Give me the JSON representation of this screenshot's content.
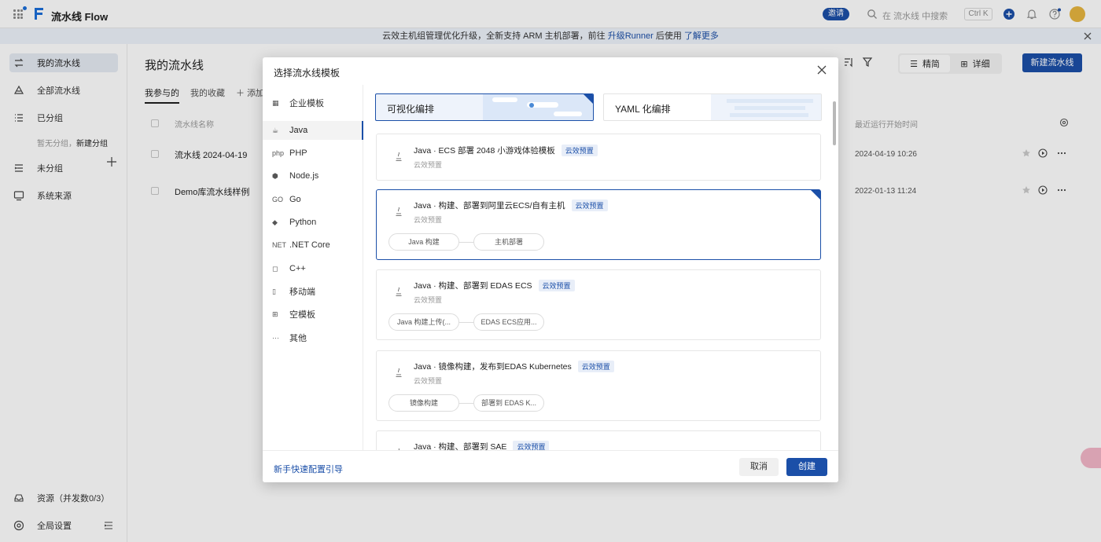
{
  "app": {
    "title": "流水线 Flow",
    "invite_label": "邀请",
    "search_placeholder": "在 流水线 中搜索",
    "shortcut": "Ctrl K"
  },
  "announcement": {
    "text_before": "云效主机组管理优化升级，全新支持 ARM 主机部署，前往 ",
    "link_upgrade": "升级Runner",
    "text_after": " 后使用 ",
    "link_more": "了解更多"
  },
  "sidebar": {
    "items": [
      {
        "label": "我的流水线",
        "icon": "pipeline-icon"
      },
      {
        "label": "全部流水线",
        "icon": "all-pipelines-icon"
      },
      {
        "label": "已分组",
        "icon": "grouped-icon"
      },
      {
        "label": "未分组",
        "icon": "ungrouped-icon"
      },
      {
        "label": "系统来源",
        "icon": "system-source-icon"
      }
    ],
    "no_group_text": "暂无分组，",
    "new_group_link": "新建分组",
    "resources_label": "资源（并发数0/3）",
    "global_settings_label": "全局设置"
  },
  "main": {
    "title": "我的流水线",
    "tabs": [
      "我参与的",
      "我的收藏",
      "添加"
    ],
    "view_compact": "精简",
    "view_detail": "详细",
    "new_pipeline_button": "新建流水线",
    "col_name": "流水线名称",
    "col_last_run": "最近运行开始时间",
    "rows": [
      {
        "name": "流水线 2024-04-19",
        "time": "2024-04-19 10:26"
      },
      {
        "name": "Demo库流水线样例",
        "time": "2022-01-13 11:24"
      }
    ]
  },
  "dialog": {
    "title": "选择流水线模板",
    "categories": [
      {
        "label": "企业模板",
        "icon": "enterprise-icon"
      },
      {
        "label": "Java",
        "icon": "java-icon"
      },
      {
        "label": "PHP",
        "icon": "php-icon"
      },
      {
        "label": "Node.js",
        "icon": "nodejs-icon"
      },
      {
        "label": "Go",
        "icon": "go-icon"
      },
      {
        "label": "Python",
        "icon": "python-icon"
      },
      {
        "label": ".NET Core",
        "icon": "dotnet-icon"
      },
      {
        "label": "C++",
        "icon": "cpp-icon"
      },
      {
        "label": "移动端",
        "icon": "mobile-icon"
      },
      {
        "label": "空模板",
        "icon": "empty-template-icon"
      },
      {
        "label": "其他",
        "icon": "more-icon"
      }
    ],
    "selected_category": "Java",
    "mode_visual": "可视化编排",
    "mode_yaml": "YAML 化编排",
    "templates": [
      {
        "name": "Java · ECS 部署 2048 小游戏体验模板",
        "badge": "云效预置",
        "sub": "云效预置",
        "stages": []
      },
      {
        "name": "Java · 构建、部署到阿里云ECS/自有主机",
        "badge": "云效预置",
        "sub": "云效预置",
        "stages": [
          "Java 构建",
          "主机部署"
        ]
      },
      {
        "name": "Java · 构建、部署到 EDAS ECS",
        "badge": "云效预置",
        "sub": "云效预置",
        "stages": [
          "Java 构建上传(...",
          "EDAS ECS应用..."
        ]
      },
      {
        "name": "Java · 镜像构建，发布到EDAS Kubernetes",
        "badge": "云效预置",
        "sub": "云效预置",
        "stages": [
          "镜像构建",
          "部署到 EDAS K..."
        ]
      },
      {
        "name": "Java · 构建、部署到 SAE",
        "badge": "云效预置",
        "sub": "",
        "stages": []
      }
    ],
    "guide_link": "新手快速配置引导",
    "cancel_label": "取消",
    "create_label": "创建"
  },
  "colors": {
    "primary": "#1b4fa8",
    "mask": "rgba(0,0,0,0.11)"
  }
}
